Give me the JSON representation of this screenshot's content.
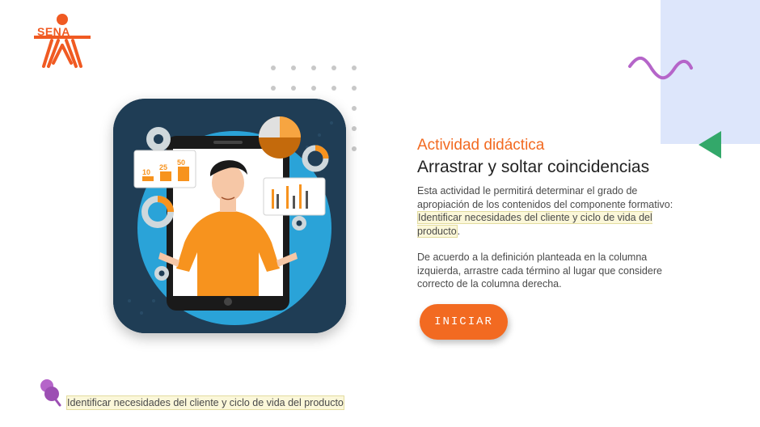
{
  "logo": {
    "text": "SENA"
  },
  "activity": {
    "eyebrow": "Actividad didáctica",
    "title": "Arrastrar y soltar coincidencias",
    "intro_text": "Esta actividad le permitirá determinar el grado de apropiación de los contenidos del componente formativo:",
    "topic": "Identificar necesidades del cliente y ciclo de vida del producto",
    "period": ".",
    "instructions": "De acuerdo a la definición planteada en la columna izquierda, arrastre cada término al lugar que considere correcto de la columna derecha."
  },
  "start_button": {
    "label": "INICIAR"
  },
  "footer": {
    "note": "Identificar necesidades del cliente y ciclo de vida del producto"
  },
  "illustration": {
    "badges": [
      "10",
      "25",
      "50"
    ]
  },
  "icons": {
    "logo": "sena-logo-icon",
    "wave": "wave-decoration-icon",
    "triangle": "triangle-decoration-icon",
    "footer": "pushpin-icon"
  },
  "colors": {
    "accent": "#f26a21",
    "decor_blue": "#dde6fb",
    "decor_purple": "#b565c9",
    "decor_green": "#33a86a",
    "highlight": "#fbf7d9"
  }
}
